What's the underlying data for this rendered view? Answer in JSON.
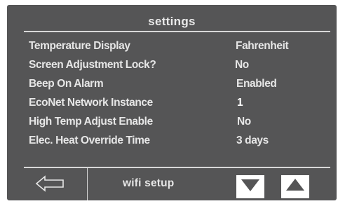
{
  "screen": {
    "title": "settings"
  },
  "settings": [
    {
      "label": "Temperature Display",
      "value": "Fahrenheit"
    },
    {
      "label": "Screen Adjustment Lock?",
      "value": "No"
    },
    {
      "label": "Beep On Alarm",
      "value": "Enabled"
    },
    {
      "label": "EcoNet Network Instance",
      "value": "1"
    },
    {
      "label": "High Temp Adjust Enable",
      "value": "No"
    },
    {
      "label": "Elec. Heat Override Time",
      "value": "3 days"
    }
  ],
  "footer": {
    "back_icon": "left-arrow-icon",
    "wifi_label": "wifi setup",
    "down_icon": "down-triangle-icon",
    "up_icon": "up-triangle-icon"
  },
  "colors": {
    "panel_bg": "#555556",
    "text": "#e6e6e6",
    "divider": "#d8d8d8",
    "button_bg": "#ffffff",
    "button_glyph": "#555556"
  }
}
